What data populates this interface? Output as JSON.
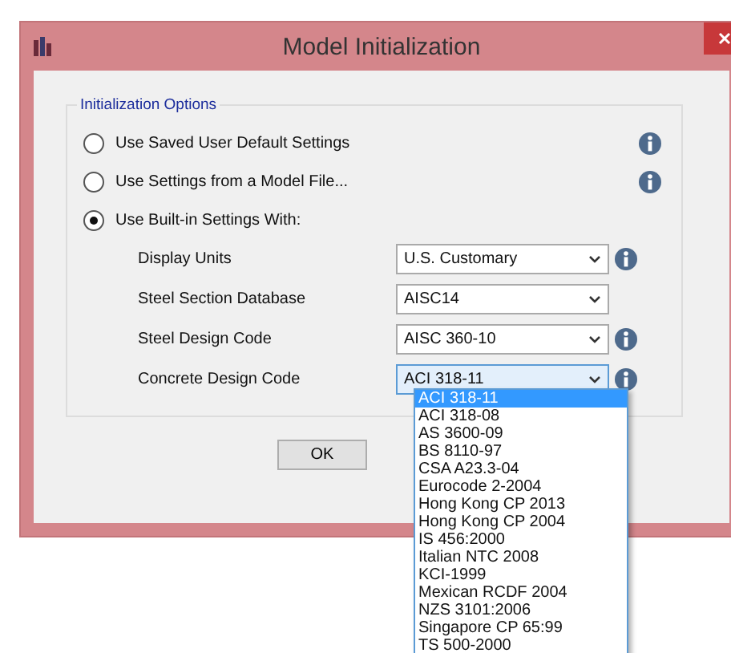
{
  "window": {
    "title": "Model Initialization"
  },
  "group": {
    "title": "Initialization Options"
  },
  "options": [
    {
      "label": "Use Saved User Default Settings",
      "selected": false,
      "info": true
    },
    {
      "label": "Use Settings from a Model File...",
      "selected": false,
      "info": true
    },
    {
      "label": "Use Built-in Settings With:",
      "selected": true,
      "info": false
    }
  ],
  "settings": [
    {
      "label": "Display Units",
      "value": "U.S. Customary",
      "info": true,
      "open": false
    },
    {
      "label": "Steel Section Database",
      "value": "AISC14",
      "info": false,
      "open": false
    },
    {
      "label": "Steel Design Code",
      "value": "AISC 360-10",
      "info": true,
      "open": false
    },
    {
      "label": "Concrete Design Code",
      "value": "ACI 318-11",
      "info": true,
      "open": true
    }
  ],
  "ok_button": "OK",
  "dropdown_items": [
    {
      "label": "ACI 318-11",
      "selected": true
    },
    {
      "label": "ACI 318-08",
      "selected": false
    },
    {
      "label": "AS 3600-09",
      "selected": false
    },
    {
      "label": "BS 8110-97",
      "selected": false
    },
    {
      "label": "CSA A23.3-04",
      "selected": false
    },
    {
      "label": "Eurocode 2-2004",
      "selected": false
    },
    {
      "label": "Hong Kong CP 2013",
      "selected": false
    },
    {
      "label": "Hong Kong CP 2004",
      "selected": false
    },
    {
      "label": "IS 456:2000",
      "selected": false
    },
    {
      "label": "Italian NTC 2008",
      "selected": false
    },
    {
      "label": "KCI-1999",
      "selected": false
    },
    {
      "label": "Mexican RCDF 2004",
      "selected": false
    },
    {
      "label": "NZS 3101:2006",
      "selected": false
    },
    {
      "label": "Singapore CP 65:99",
      "selected": false
    },
    {
      "label": "TS 500-2000",
      "selected": false
    }
  ]
}
